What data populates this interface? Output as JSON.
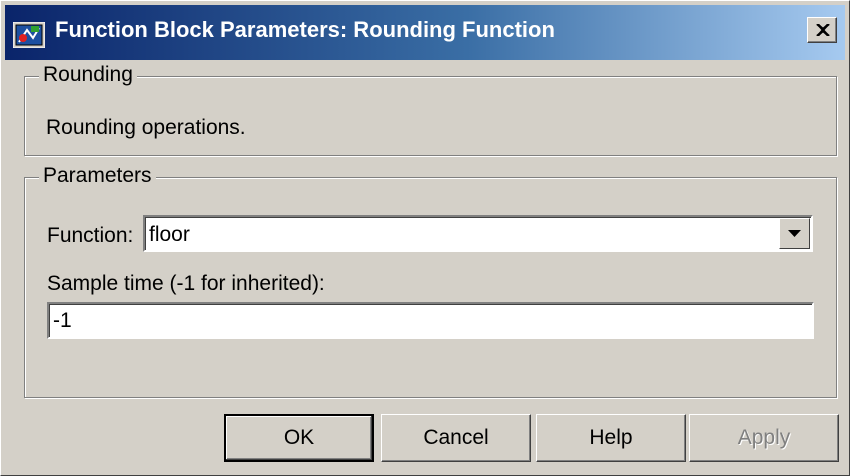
{
  "window": {
    "title": "Function Block Parameters: Rounding Function"
  },
  "rounding_group": {
    "legend": "Rounding",
    "description": "Rounding operations."
  },
  "parameters_group": {
    "legend": "Parameters",
    "function_label": "Function:",
    "function_value": "floor",
    "sample_time_label": "Sample time (-1 for inherited):",
    "sample_time_value": "-1"
  },
  "buttons": {
    "ok": "OK",
    "cancel": "Cancel",
    "help": "Help",
    "apply": "Apply"
  },
  "icons": {
    "app": "simulink-block-icon",
    "close": "close-icon",
    "dropdown": "chevron-down-icon"
  },
  "colors": {
    "titlebar_start": "#0a246a",
    "titlebar_end": "#a6caf0",
    "dialog_face": "#d4d0c8"
  }
}
